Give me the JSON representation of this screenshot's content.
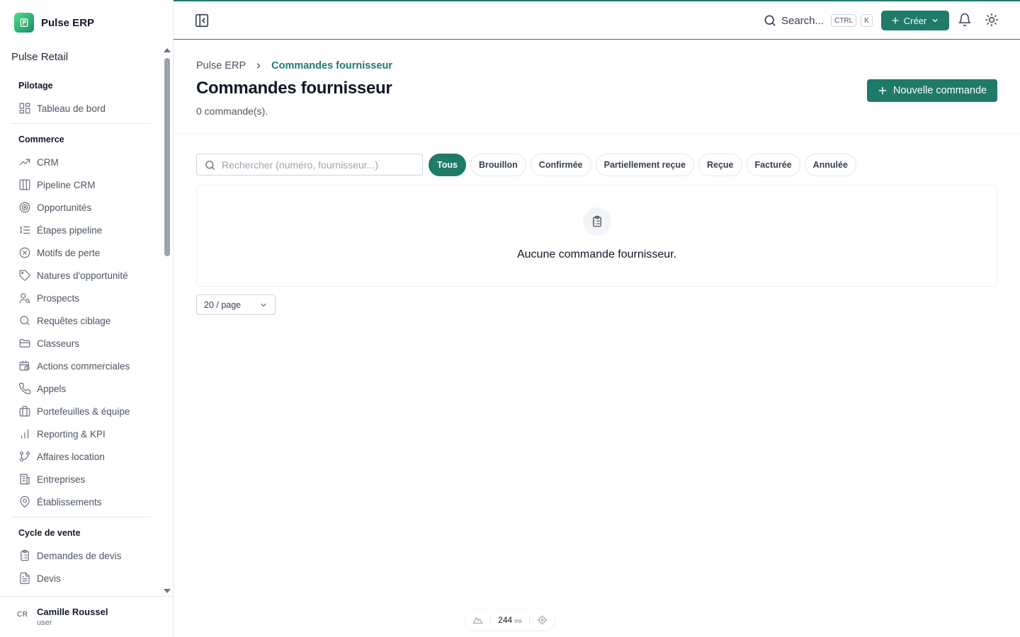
{
  "app": {
    "name": "Pulse ERP",
    "org": "Pulse Retail"
  },
  "sidebar": {
    "sections": [
      {
        "title": "Pilotage",
        "items": [
          {
            "label": "Tableau de bord",
            "icon": "dashboard-icon"
          }
        ]
      },
      {
        "title": "Commerce",
        "items": [
          {
            "label": "CRM",
            "icon": "trend-icon"
          },
          {
            "label": "Pipeline CRM",
            "icon": "columns-icon"
          },
          {
            "label": "Opportunités",
            "icon": "target-icon"
          },
          {
            "label": "Étapes pipeline",
            "icon": "list-ordered-icon"
          },
          {
            "label": "Motifs de perte",
            "icon": "x-circle-icon"
          },
          {
            "label": "Natures d'opportunité",
            "icon": "tag-icon"
          },
          {
            "label": "Prospects",
            "icon": "user-search-icon"
          },
          {
            "label": "Requêtes ciblage",
            "icon": "search-icon"
          },
          {
            "label": "Classeurs",
            "icon": "folder-icon"
          },
          {
            "label": "Actions commerciales",
            "icon": "calendar-clock-icon"
          },
          {
            "label": "Appels",
            "icon": "phone-icon"
          },
          {
            "label": "Portefeuilles & équipe",
            "icon": "briefcase-icon"
          },
          {
            "label": "Reporting & KPI",
            "icon": "bar-chart-icon"
          },
          {
            "label": "Affaires location",
            "icon": "git-branch-icon"
          },
          {
            "label": "Entreprises",
            "icon": "building-icon"
          },
          {
            "label": "Établissements",
            "icon": "map-pin-icon"
          }
        ]
      },
      {
        "title": "Cycle de vente",
        "items": [
          {
            "label": "Demandes de devis",
            "icon": "clipboard-list-icon"
          },
          {
            "label": "Devis",
            "icon": "file-text-icon"
          }
        ]
      }
    ],
    "user": {
      "initials": "CR",
      "name": "Camille Roussel",
      "role": "user"
    }
  },
  "topbar": {
    "search_label": "Search...",
    "kbd": [
      "CTRL",
      "K"
    ],
    "create_label": "Créer"
  },
  "breadcrumb": {
    "root": "Pulse ERP",
    "current": "Commandes fournisseur"
  },
  "page": {
    "title": "Commandes fournisseur",
    "count": "0 commande(s).",
    "new_button": "Nouvelle commande"
  },
  "filters": {
    "search_placeholder": "Rechercher (numéro, fournisseur...)",
    "statuses": [
      "Tous",
      "Brouillon",
      "Confirmée",
      "Partiellement reçue",
      "Reçue",
      "Facturée",
      "Annulée"
    ],
    "active_status": "Tous"
  },
  "empty_state": {
    "message": "Aucune commande fournisseur."
  },
  "pagination": {
    "page_size": "20 / page"
  },
  "perf": {
    "value": "244",
    "unit": "ms"
  },
  "colors": {
    "accent": "#1f7a6a"
  }
}
